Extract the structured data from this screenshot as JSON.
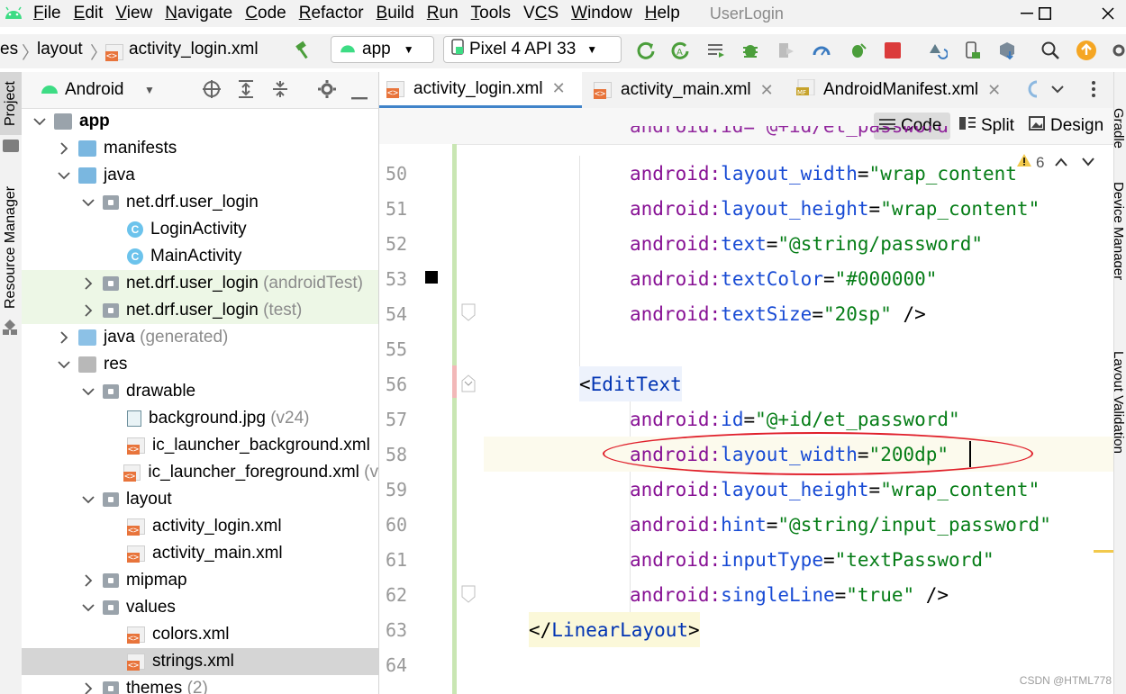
{
  "menu": {
    "items": [
      "File",
      "Edit",
      "View",
      "Navigate",
      "Code",
      "Refactor",
      "Build",
      "Run",
      "Tools",
      "VCS",
      "Window",
      "Help"
    ],
    "underline_index": [
      0,
      0,
      0,
      0,
      0,
      0,
      0,
      0,
      0,
      1,
      0,
      0
    ],
    "project_title": "UserLogin"
  },
  "toolbar": {
    "breadcrumb_prefix": "es",
    "breadcrumb_folder": "layout",
    "breadcrumb_file": "activity_login.xml",
    "run_config": "app",
    "device": "Pixel 4 API 33"
  },
  "left_strip": {
    "project_tab": "Project",
    "resource_manager_tab": "Resource Manager"
  },
  "project_panel": {
    "view_mode": "Android",
    "tree": [
      {
        "label": "app",
        "suffix": "",
        "icon": "app-module-icon",
        "level": 0,
        "expand": "open",
        "bold": true
      },
      {
        "label": "manifests",
        "suffix": "",
        "icon": "folder-icon",
        "level": 1,
        "expand": "closed"
      },
      {
        "label": "java",
        "suffix": "",
        "icon": "folder-icon",
        "level": 1,
        "expand": "open"
      },
      {
        "label": "net.drf.user_login",
        "suffix": "",
        "icon": "package-icon",
        "level": 2,
        "expand": "open"
      },
      {
        "label": "LoginActivity",
        "suffix": "",
        "icon": "class-icon",
        "level": 3,
        "expand": "none"
      },
      {
        "label": "MainActivity",
        "suffix": "",
        "icon": "class-icon",
        "level": 3,
        "expand": "none"
      },
      {
        "label": "net.drf.user_login",
        "suffix": " (androidTest)",
        "icon": "package-icon",
        "level": 2,
        "expand": "closed",
        "tinted": true
      },
      {
        "label": "net.drf.user_login",
        "suffix": " (test)",
        "icon": "package-icon",
        "level": 2,
        "expand": "closed",
        "tinted": true
      },
      {
        "label": "java",
        "suffix": " (generated)",
        "icon": "generated-folder-icon",
        "level": 1,
        "expand": "closed"
      },
      {
        "label": "res",
        "suffix": "",
        "icon": "res-folder-icon",
        "level": 1,
        "expand": "open"
      },
      {
        "label": "drawable",
        "suffix": "",
        "icon": "package-icon",
        "level": 2,
        "expand": "open"
      },
      {
        "label": "background.jpg",
        "suffix": " (v24)",
        "icon": "image-file-icon",
        "level": 3,
        "expand": "none"
      },
      {
        "label": "ic_launcher_background.xml",
        "suffix": "",
        "icon": "xml-file-icon",
        "level": 3,
        "expand": "none"
      },
      {
        "label": "ic_launcher_foreground.xml",
        "suffix": " (v",
        "icon": "xml-file-icon",
        "level": 3,
        "expand": "none"
      },
      {
        "label": "layout",
        "suffix": "",
        "icon": "package-icon",
        "level": 2,
        "expand": "open"
      },
      {
        "label": "activity_login.xml",
        "suffix": "",
        "icon": "xml-file-icon",
        "level": 3,
        "expand": "none"
      },
      {
        "label": "activity_main.xml",
        "suffix": "",
        "icon": "xml-file-icon",
        "level": 3,
        "expand": "none"
      },
      {
        "label": "mipmap",
        "suffix": "",
        "icon": "package-icon",
        "level": 2,
        "expand": "closed"
      },
      {
        "label": "values",
        "suffix": "",
        "icon": "package-icon",
        "level": 2,
        "expand": "open"
      },
      {
        "label": "colors.xml",
        "suffix": "",
        "icon": "xml-file-icon",
        "level": 3,
        "expand": "none"
      },
      {
        "label": "strings.xml",
        "suffix": "",
        "icon": "xml-file-icon",
        "level": 3,
        "expand": "none",
        "selected": true
      },
      {
        "label": "themes",
        "suffix": " (2)",
        "icon": "package-icon",
        "level": 2,
        "expand": "closed"
      }
    ]
  },
  "editor": {
    "tabs": [
      {
        "label": "activity_login.xml",
        "active": true,
        "icon": "xml-file-icon"
      },
      {
        "label": "activity_main.xml",
        "active": false,
        "icon": "xml-file-icon"
      },
      {
        "label": "AndroidManifest.xml",
        "active": false,
        "icon": "manifest-file-icon"
      }
    ],
    "view_modes": [
      "Code",
      "Split",
      "Design"
    ],
    "active_view": "Code",
    "warning_count": "6",
    "lines": [
      {
        "n": "50",
        "indent": 2,
        "ns": "android",
        "name": "layout_width",
        "value": "\"wrap_content\""
      },
      {
        "n": "51",
        "indent": 2,
        "ns": "android",
        "name": "layout_height",
        "value": "\"wrap_content\""
      },
      {
        "n": "52",
        "indent": 2,
        "ns": "android",
        "name": "text",
        "value": "\"@string/password\""
      },
      {
        "n": "53",
        "indent": 2,
        "ns": "android",
        "name": "textColor",
        "value": "\"#000000\""
      },
      {
        "n": "54",
        "indent": 2,
        "ns": "android",
        "name": "textSize",
        "value": "\"20sp\"",
        "tail": " />"
      },
      {
        "n": "55",
        "blank": true
      },
      {
        "n": "56",
        "indent": 1,
        "tagopen": "<",
        "tag": "EditText"
      },
      {
        "n": "57",
        "indent": 2,
        "ns": "android",
        "name": "id",
        "value": "\"@+id/et_password\""
      },
      {
        "n": "58",
        "indent": 2,
        "ns": "android",
        "name": "layout_width",
        "value": "\"200dp\"",
        "current": true
      },
      {
        "n": "59",
        "indent": 2,
        "ns": "android",
        "name": "layout_height",
        "value": "\"wrap_content\""
      },
      {
        "n": "60",
        "indent": 2,
        "ns": "android",
        "name": "hint",
        "value": "\"@string/input_password\""
      },
      {
        "n": "61",
        "indent": 2,
        "ns": "android",
        "name": "inputType",
        "value": "\"textPassword\""
      },
      {
        "n": "62",
        "indent": 2,
        "ns": "android",
        "name": "singleLine",
        "value": "\"true\"",
        "tail": " />"
      },
      {
        "n": "63",
        "indent": 0,
        "tagopen": "</",
        "tag": "LinearLayout",
        "tagclose": ">"
      },
      {
        "n": "64",
        "blank": true
      }
    ]
  },
  "right_strip": {
    "tabs": [
      "Gradle",
      "Device Manager",
      "Layout Validation"
    ]
  },
  "watermark": "CSDN @HTML778",
  "colors": {
    "accent": "#4083c9",
    "gutter_change": "#c9e6b3",
    "annotation": "#e0202b"
  }
}
